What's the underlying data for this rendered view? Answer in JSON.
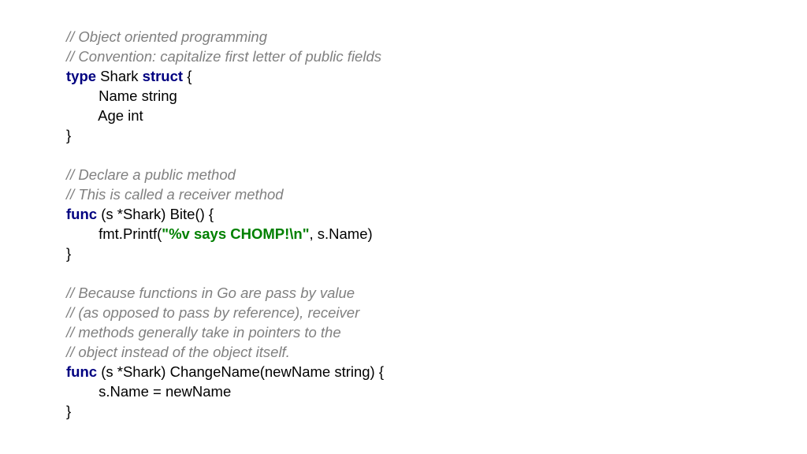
{
  "code": {
    "lines": [
      {
        "tokens": [
          {
            "cls": "comment",
            "text": "// Object oriented programming"
          }
        ]
      },
      {
        "tokens": [
          {
            "cls": "comment",
            "text": "// Convention: capitalize first letter of public fields"
          }
        ]
      },
      {
        "tokens": [
          {
            "cls": "keyword",
            "text": "type"
          },
          {
            "cls": "plain",
            "text": " Shark "
          },
          {
            "cls": "keyword",
            "text": "struct"
          },
          {
            "cls": "plain",
            "text": " {"
          }
        ]
      },
      {
        "tokens": [
          {
            "cls": "plain",
            "text": "        Name string"
          }
        ]
      },
      {
        "tokens": [
          {
            "cls": "plain",
            "text": "        Age int"
          }
        ]
      },
      {
        "tokens": [
          {
            "cls": "plain",
            "text": "}"
          }
        ]
      },
      {
        "tokens": [
          {
            "cls": "plain",
            "text": ""
          }
        ]
      },
      {
        "tokens": [
          {
            "cls": "comment",
            "text": "// Declare a public method"
          }
        ]
      },
      {
        "tokens": [
          {
            "cls": "comment",
            "text": "// This is called a receiver method"
          }
        ]
      },
      {
        "tokens": [
          {
            "cls": "keyword",
            "text": "func"
          },
          {
            "cls": "plain",
            "text": " (s *Shark) Bite() {"
          }
        ]
      },
      {
        "tokens": [
          {
            "cls": "plain",
            "text": "        fmt.Printf("
          },
          {
            "cls": "string",
            "text": "\"%v says CHOMP!\\n\""
          },
          {
            "cls": "plain",
            "text": ", s.Name)"
          }
        ]
      },
      {
        "tokens": [
          {
            "cls": "plain",
            "text": "}"
          }
        ]
      },
      {
        "tokens": [
          {
            "cls": "plain",
            "text": ""
          }
        ]
      },
      {
        "tokens": [
          {
            "cls": "comment",
            "text": "// Because functions in Go are pass by value"
          }
        ]
      },
      {
        "tokens": [
          {
            "cls": "comment",
            "text": "// (as opposed to pass by reference), receiver"
          }
        ]
      },
      {
        "tokens": [
          {
            "cls": "comment",
            "text": "// methods generally take in pointers to the"
          }
        ]
      },
      {
        "tokens": [
          {
            "cls": "comment",
            "text": "// object instead of the object itself."
          }
        ]
      },
      {
        "tokens": [
          {
            "cls": "keyword",
            "text": "func"
          },
          {
            "cls": "plain",
            "text": " (s *Shark) ChangeName(newName string) {"
          }
        ]
      },
      {
        "tokens": [
          {
            "cls": "plain",
            "text": "        s.Name = newName"
          }
        ]
      },
      {
        "tokens": [
          {
            "cls": "plain",
            "text": "}"
          }
        ]
      }
    ]
  }
}
